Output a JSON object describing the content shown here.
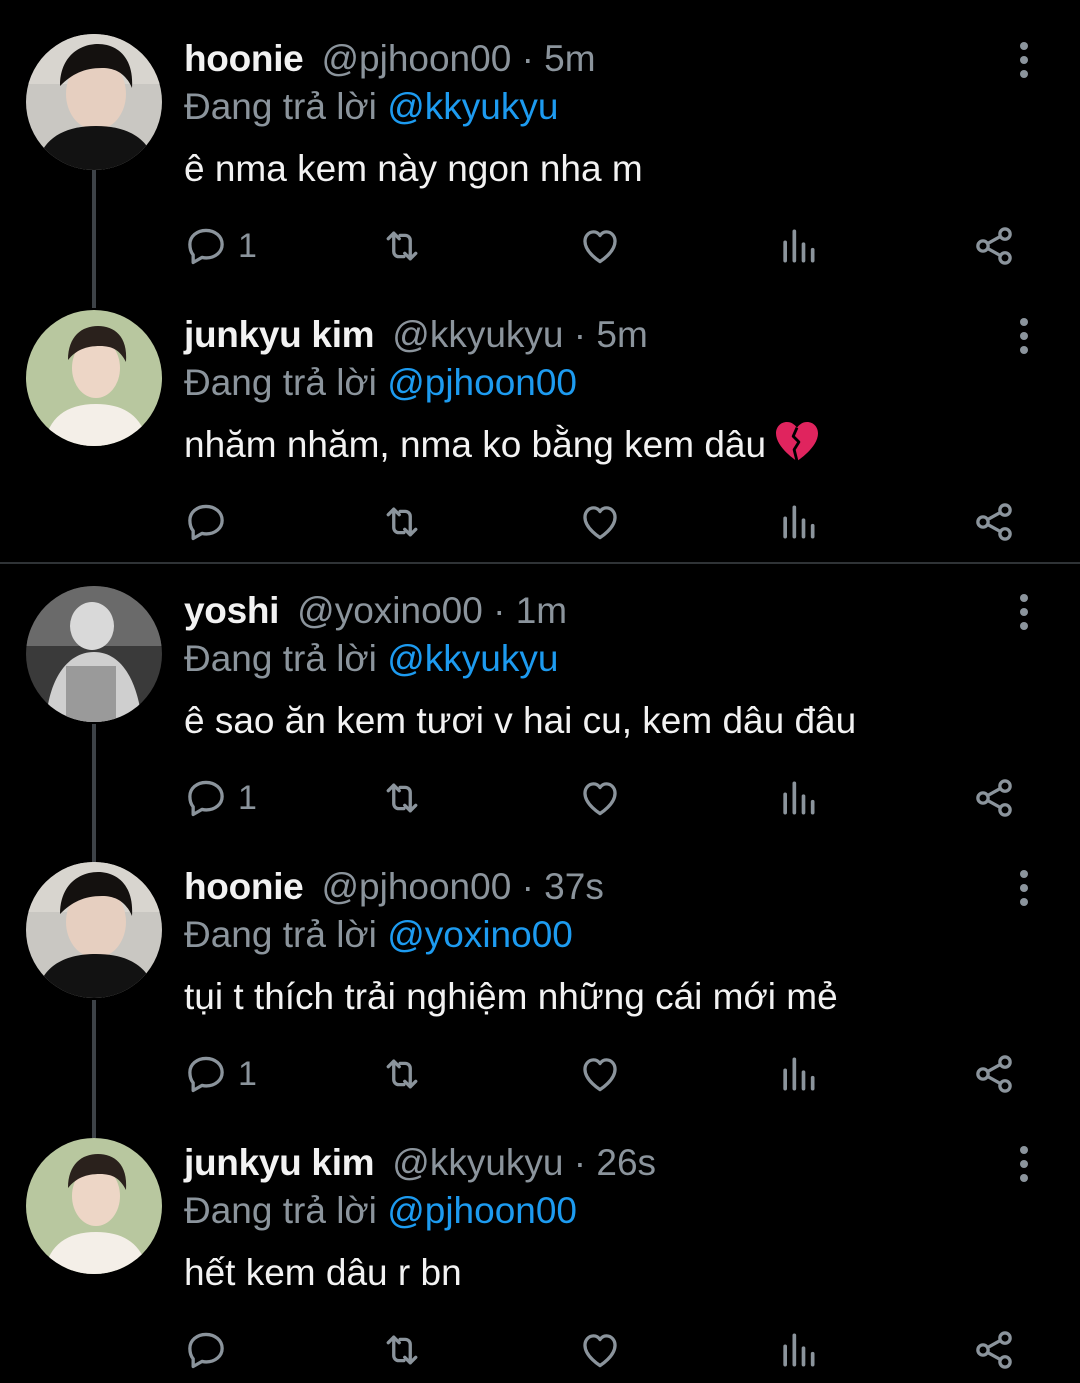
{
  "colors": {
    "background": "#000000",
    "mention": "#1d9bf0",
    "muted": "#8b949c",
    "text": "#f2f2f2",
    "heart_broken": "#e0245e"
  },
  "icons": {
    "more": "more-vertical-icon",
    "reply": "reply-icon",
    "retweet": "retweet-icon",
    "like": "heart-icon",
    "views": "views-icon",
    "share": "share-icon",
    "emoji": "broken-heart-emoji"
  },
  "tweets": [
    {
      "name": "hoonie",
      "handle": "@pjhoon00 · 5m",
      "replying_label": "Đang trả lời",
      "replying_to": "@kkyukyu",
      "text": "ê nma kem này ngon nha m",
      "reply_count": "1"
    },
    {
      "name": "junkyu kim",
      "handle": "@kkyukyu · 5m",
      "replying_label": "Đang trả lời",
      "replying_to": "@pjhoon00",
      "text": "nhăm nhăm, nma ko bằng kem dâu",
      "reply_count": ""
    },
    {
      "name": "yoshi",
      "handle": "@yoxino00 · 1m",
      "replying_label": "Đang trả lời",
      "replying_to": "@kkyukyu",
      "text": "ê sao ăn kem tươi v hai cu, kem dâu đâu",
      "reply_count": "1"
    },
    {
      "name": "hoonie",
      "handle": "@pjhoon00 · 37s",
      "replying_label": "Đang trả lời",
      "replying_to": "@yoxino00",
      "text": "tụi t thích trải nghiệm những cái mới mẻ",
      "reply_count": "1"
    },
    {
      "name": "junkyu kim",
      "handle": "@kkyukyu · 26s",
      "replying_label": "Đang trả lời",
      "replying_to": "@pjhoon00",
      "text": "hết kem dâu r bn",
      "reply_count": ""
    }
  ]
}
